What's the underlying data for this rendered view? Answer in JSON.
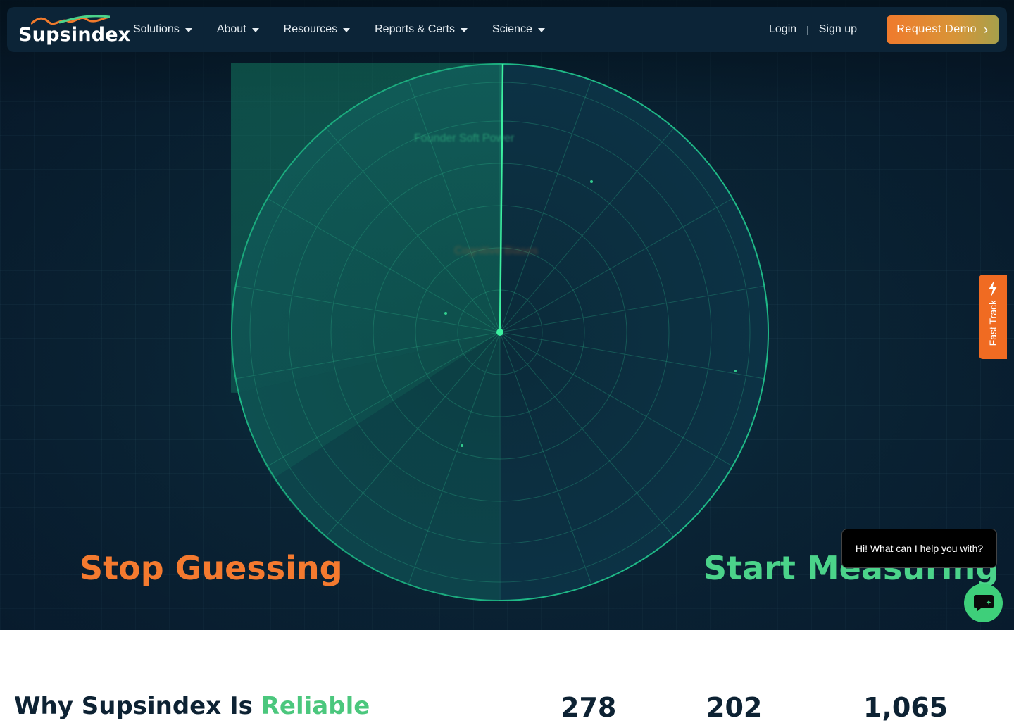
{
  "nav": {
    "logo_text": "Supsindex",
    "items": [
      {
        "label": "Solutions"
      },
      {
        "label": "About"
      },
      {
        "label": "Resources"
      },
      {
        "label": "Reports & Certs"
      },
      {
        "label": "Science"
      }
    ],
    "login": "Login",
    "separator": "|",
    "signup": "Sign up",
    "demo_label": "Request Demo"
  },
  "hero": {
    "radar_labels": {
      "founder": "Founder Soft Power",
      "cognitive": "Cognitive Biases"
    },
    "stop": "Stop Guessing",
    "start": "Start Measuring"
  },
  "widgets": {
    "fast_track": "Fast Track",
    "chat_greeting": "Hi! What can I help you with?"
  },
  "section": {
    "title_prefix": "Why Supsindex Is ",
    "title_accent": "Reliable",
    "stats": [
      "278",
      "202",
      "1,065"
    ]
  },
  "colors": {
    "accent_orange": "#f47a2f",
    "accent_green": "#4bd38a",
    "navy": "#0d2233"
  }
}
